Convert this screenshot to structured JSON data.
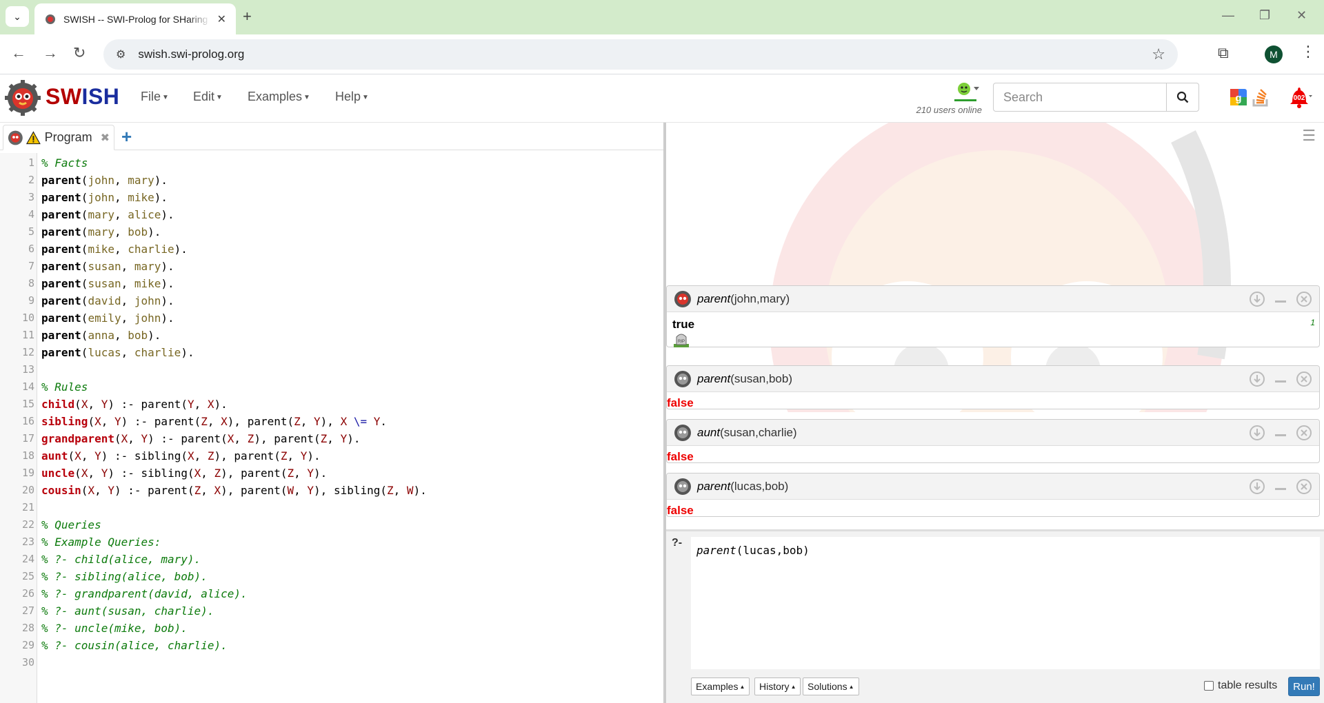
{
  "browser": {
    "tab_title": "SWISH -- SWI-Prolog for SHaring",
    "url": "swish.swi-prolog.org",
    "profile_initial": "M"
  },
  "navbar": {
    "brand_red": "SW",
    "brand_blue": "ISH",
    "menus": [
      "File",
      "Edit",
      "Examples",
      "Help"
    ],
    "users_online": "210 users online",
    "search_placeholder": "Search",
    "notification_count": "002"
  },
  "editor": {
    "tab_label": "Program",
    "lines": [
      [
        [
          "c",
          "% Facts"
        ]
      ],
      [
        [
          "f",
          "parent"
        ],
        [
          "p",
          "("
        ],
        [
          "a",
          "john"
        ],
        [
          "p",
          ", "
        ],
        [
          "a",
          "mary"
        ],
        [
          "p",
          ")."
        ]
      ],
      [
        [
          "f",
          "parent"
        ],
        [
          "p",
          "("
        ],
        [
          "a",
          "john"
        ],
        [
          "p",
          ", "
        ],
        [
          "a",
          "mike"
        ],
        [
          "p",
          ")."
        ]
      ],
      [
        [
          "f",
          "parent"
        ],
        [
          "p",
          "("
        ],
        [
          "a",
          "mary"
        ],
        [
          "p",
          ", "
        ],
        [
          "a",
          "alice"
        ],
        [
          "p",
          ")."
        ]
      ],
      [
        [
          "f",
          "parent"
        ],
        [
          "p",
          "("
        ],
        [
          "a",
          "mary"
        ],
        [
          "p",
          ", "
        ],
        [
          "a",
          "bob"
        ],
        [
          "p",
          ")."
        ]
      ],
      [
        [
          "f",
          "parent"
        ],
        [
          "p",
          "("
        ],
        [
          "a",
          "mike"
        ],
        [
          "p",
          ", "
        ],
        [
          "a",
          "charlie"
        ],
        [
          "p",
          ")."
        ]
      ],
      [
        [
          "f",
          "parent"
        ],
        [
          "p",
          "("
        ],
        [
          "a",
          "susan"
        ],
        [
          "p",
          ", "
        ],
        [
          "a",
          "mary"
        ],
        [
          "p",
          ")."
        ]
      ],
      [
        [
          "f",
          "parent"
        ],
        [
          "p",
          "("
        ],
        [
          "a",
          "susan"
        ],
        [
          "p",
          ", "
        ],
        [
          "a",
          "mike"
        ],
        [
          "p",
          ")."
        ]
      ],
      [
        [
          "f",
          "parent"
        ],
        [
          "p",
          "("
        ],
        [
          "a",
          "david"
        ],
        [
          "p",
          ", "
        ],
        [
          "a",
          "john"
        ],
        [
          "p",
          ")."
        ]
      ],
      [
        [
          "f",
          "parent"
        ],
        [
          "p",
          "("
        ],
        [
          "a",
          "emily"
        ],
        [
          "p",
          ", "
        ],
        [
          "a",
          "john"
        ],
        [
          "p",
          ")."
        ]
      ],
      [
        [
          "f",
          "parent"
        ],
        [
          "p",
          "("
        ],
        [
          "a",
          "anna"
        ],
        [
          "p",
          ", "
        ],
        [
          "a",
          "bob"
        ],
        [
          "p",
          ")."
        ]
      ],
      [
        [
          "f",
          "parent"
        ],
        [
          "p",
          "("
        ],
        [
          "a",
          "lucas"
        ],
        [
          "p",
          ", "
        ],
        [
          "a",
          "charlie"
        ],
        [
          "p",
          ")."
        ]
      ],
      [],
      [
        [
          "c",
          "% Rules"
        ]
      ],
      [
        [
          "h",
          "child"
        ],
        [
          "p",
          "("
        ],
        [
          "v",
          "X"
        ],
        [
          "p",
          ", "
        ],
        [
          "v",
          "Y"
        ],
        [
          "p",
          ") :- "
        ],
        [
          "k",
          "parent"
        ],
        [
          "p",
          "("
        ],
        [
          "v",
          "Y"
        ],
        [
          "p",
          ", "
        ],
        [
          "v",
          "X"
        ],
        [
          "p",
          ")."
        ]
      ],
      [
        [
          "h",
          "sibling"
        ],
        [
          "p",
          "("
        ],
        [
          "v",
          "X"
        ],
        [
          "p",
          ", "
        ],
        [
          "v",
          "Y"
        ],
        [
          "p",
          ") :- "
        ],
        [
          "k",
          "parent"
        ],
        [
          "p",
          "("
        ],
        [
          "v",
          "Z"
        ],
        [
          "p",
          ", "
        ],
        [
          "v",
          "X"
        ],
        [
          "p",
          "), "
        ],
        [
          "k",
          "parent"
        ],
        [
          "p",
          "("
        ],
        [
          "v",
          "Z"
        ],
        [
          "p",
          ", "
        ],
        [
          "v",
          "Y"
        ],
        [
          "p",
          "), "
        ],
        [
          "v",
          "X"
        ],
        [
          "o",
          " \\= "
        ],
        [
          "v",
          "Y"
        ],
        [
          "p",
          "."
        ]
      ],
      [
        [
          "h",
          "grandparent"
        ],
        [
          "p",
          "("
        ],
        [
          "v",
          "X"
        ],
        [
          "p",
          ", "
        ],
        [
          "v",
          "Y"
        ],
        [
          "p",
          ") :- "
        ],
        [
          "k",
          "parent"
        ],
        [
          "p",
          "("
        ],
        [
          "v",
          "X"
        ],
        [
          "p",
          ", "
        ],
        [
          "v",
          "Z"
        ],
        [
          "p",
          "), "
        ],
        [
          "k",
          "parent"
        ],
        [
          "p",
          "("
        ],
        [
          "v",
          "Z"
        ],
        [
          "p",
          ", "
        ],
        [
          "v",
          "Y"
        ],
        [
          "p",
          ")."
        ]
      ],
      [
        [
          "h",
          "aunt"
        ],
        [
          "p",
          "("
        ],
        [
          "v",
          "X"
        ],
        [
          "p",
          ", "
        ],
        [
          "v",
          "Y"
        ],
        [
          "p",
          ") :- "
        ],
        [
          "k",
          "sibling"
        ],
        [
          "p",
          "("
        ],
        [
          "v",
          "X"
        ],
        [
          "p",
          ", "
        ],
        [
          "v",
          "Z"
        ],
        [
          "p",
          "), "
        ],
        [
          "k",
          "parent"
        ],
        [
          "p",
          "("
        ],
        [
          "v",
          "Z"
        ],
        [
          "p",
          ", "
        ],
        [
          "v",
          "Y"
        ],
        [
          "p",
          ")."
        ]
      ],
      [
        [
          "h",
          "uncle"
        ],
        [
          "p",
          "("
        ],
        [
          "v",
          "X"
        ],
        [
          "p",
          ", "
        ],
        [
          "v",
          "Y"
        ],
        [
          "p",
          ") :- "
        ],
        [
          "k",
          "sibling"
        ],
        [
          "p",
          "("
        ],
        [
          "v",
          "X"
        ],
        [
          "p",
          ", "
        ],
        [
          "v",
          "Z"
        ],
        [
          "p",
          "), "
        ],
        [
          "k",
          "parent"
        ],
        [
          "p",
          "("
        ],
        [
          "v",
          "Z"
        ],
        [
          "p",
          ", "
        ],
        [
          "v",
          "Y"
        ],
        [
          "p",
          ")."
        ]
      ],
      [
        [
          "h",
          "cousin"
        ],
        [
          "p",
          "("
        ],
        [
          "v",
          "X"
        ],
        [
          "p",
          ", "
        ],
        [
          "v",
          "Y"
        ],
        [
          "p",
          ") :- "
        ],
        [
          "k",
          "parent"
        ],
        [
          "p",
          "("
        ],
        [
          "v",
          "Z"
        ],
        [
          "p",
          ", "
        ],
        [
          "v",
          "X"
        ],
        [
          "p",
          "), "
        ],
        [
          "k",
          "parent"
        ],
        [
          "p",
          "("
        ],
        [
          "v",
          "W"
        ],
        [
          "p",
          ", "
        ],
        [
          "v",
          "Y"
        ],
        [
          "p",
          "), "
        ],
        [
          "k",
          "sibling"
        ],
        [
          "p",
          "("
        ],
        [
          "v",
          "Z"
        ],
        [
          "p",
          ", "
        ],
        [
          "v",
          "W"
        ],
        [
          "p",
          ")."
        ]
      ],
      [],
      [
        [
          "c",
          "% Queries"
        ]
      ],
      [
        [
          "c",
          "% Example Queries:"
        ]
      ],
      [
        [
          "c",
          "% ?- child(alice, mary)."
        ]
      ],
      [
        [
          "c",
          "% ?- sibling(alice, bob)."
        ]
      ],
      [
        [
          "c",
          "% ?- grandparent(david, alice)."
        ]
      ],
      [
        [
          "c",
          "% ?- aunt(susan, charlie)."
        ]
      ],
      [
        [
          "c",
          "% ?- uncle(mike, bob)."
        ]
      ],
      [
        [
          "c",
          "% ?- cousin(alice, charlie)."
        ]
      ],
      []
    ]
  },
  "results": [
    {
      "pred": "parent",
      "args": "(john,mary)",
      "answer": "true",
      "count": "1"
    },
    {
      "pred": "parent",
      "args": "(susan,bob)",
      "answer": "false"
    },
    {
      "pred": "aunt",
      "args": "(susan,charlie)",
      "answer": "false"
    },
    {
      "pred": "parent",
      "args": "(lucas,bob)",
      "answer": "false"
    }
  ],
  "query": {
    "prompt": "?-",
    "pred": "parent",
    "args": "(lucas,bob)",
    "examples_label": "Examples",
    "history_label": "History",
    "solutions_label": "Solutions",
    "table_results_label": "table results",
    "run_label": "Run!"
  }
}
